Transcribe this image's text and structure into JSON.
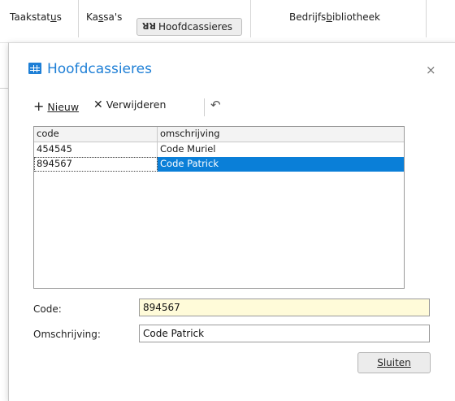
{
  "ribbon": {
    "items": [
      {
        "label": "Taakstatus",
        "underline": "u"
      },
      {
        "label": "Kassa's",
        "underline": "s"
      },
      {
        "label": "Hoofdcassieres",
        "icon": "people-icon"
      },
      {
        "label": "Bedrijfsbibliotheek",
        "underline": "b"
      }
    ]
  },
  "dialog": {
    "title": "Hoofdcassieres",
    "icon": "table-icon",
    "close": "×",
    "toolbar": {
      "new_label": "Nieuw",
      "delete_label": "Verwijderen",
      "undo_icon": "undo-icon"
    },
    "grid": {
      "columns": [
        "code",
        "omschrijving"
      ],
      "rows": [
        {
          "code": "454545",
          "omschrijving": "Code Muriel"
        },
        {
          "code": "894567",
          "omschrijving": "Code Patrick"
        }
      ],
      "selected_index": 1
    },
    "form": {
      "code_label": "Code:",
      "code_value": "894567",
      "omschrijving_label": "Omschrijving:",
      "omschrijving_value": "Code Patrick"
    },
    "close_button": "Sluiten"
  },
  "colors": {
    "accent": "#1e7fd6",
    "selection": "#0a7fd8",
    "highlight_field": "#fffbd9"
  }
}
